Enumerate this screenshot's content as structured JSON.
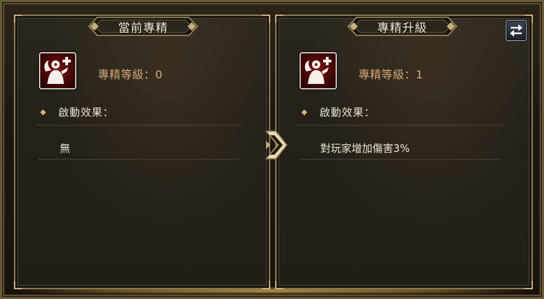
{
  "current": {
    "title": "當前專精",
    "level_label": "專精等級：0",
    "section_label": "啟動效果：",
    "effect": "無"
  },
  "upgrade": {
    "title": "專精升級",
    "level_label": "專精等級：1",
    "section_label": "啟動效果：",
    "effect": "對玩家增加傷害3%"
  },
  "icons": {
    "skill": "warrior-plus-icon",
    "swap": "swap-arrows-icon",
    "next": "chevron-right-icon"
  },
  "colors": {
    "level_text": "#d9a77a",
    "body_text": "#ece5d6",
    "border_gold": "#c9b07a",
    "icon_red": "#7a1010"
  }
}
